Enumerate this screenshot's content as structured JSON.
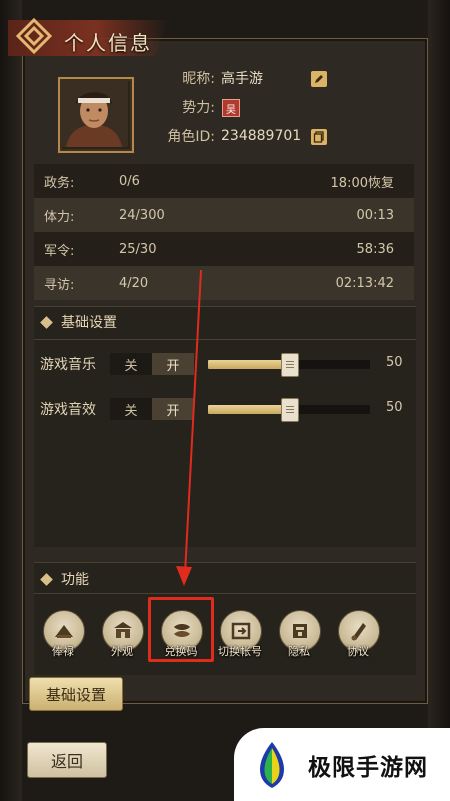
{
  "window": {
    "title": "个人信息"
  },
  "profile": {
    "nickname_label": "昵称:",
    "nickname_value": "高手游",
    "faction_label": "势力:",
    "faction_badge": "吴",
    "roleid_label": "角色ID:",
    "roleid_value": "234889701"
  },
  "stats": [
    {
      "label": "政务:",
      "value": "0/6",
      "right": "18:00恢复"
    },
    {
      "label": "体力:",
      "value": "24/300",
      "right": "00:13"
    },
    {
      "label": "军令:",
      "value": "25/30",
      "right": "58:36"
    },
    {
      "label": "寻访:",
      "value": "4/20",
      "right": "02:13:42"
    }
  ],
  "settings": {
    "section_title": "基础设置",
    "music": {
      "label": "游戏音乐",
      "off": "关",
      "on": "开",
      "value": "50",
      "level": 0.5
    },
    "sfx": {
      "label": "游戏音效",
      "off": "关",
      "on": "开",
      "value": "50",
      "level": 0.5
    }
  },
  "functions": {
    "section_title": "功能",
    "items": [
      {
        "label": "俸禄",
        "icon": "salary-icon"
      },
      {
        "label": "外观",
        "icon": "appearance-icon"
      },
      {
        "label": "兑换码",
        "icon": "redeem-code-icon"
      },
      {
        "label": "切换帐号",
        "icon": "switch-account-icon"
      },
      {
        "label": "隐私",
        "icon": "privacy-icon"
      },
      {
        "label": "协议",
        "icon": "agreement-icon"
      }
    ]
  },
  "bottom_tab": {
    "label": "基础设置"
  },
  "back_button": {
    "label": "返回"
  },
  "watermark": {
    "text": "极限手游网"
  },
  "colors": {
    "highlight": "#e02b1f",
    "gold": "#d9b366"
  }
}
